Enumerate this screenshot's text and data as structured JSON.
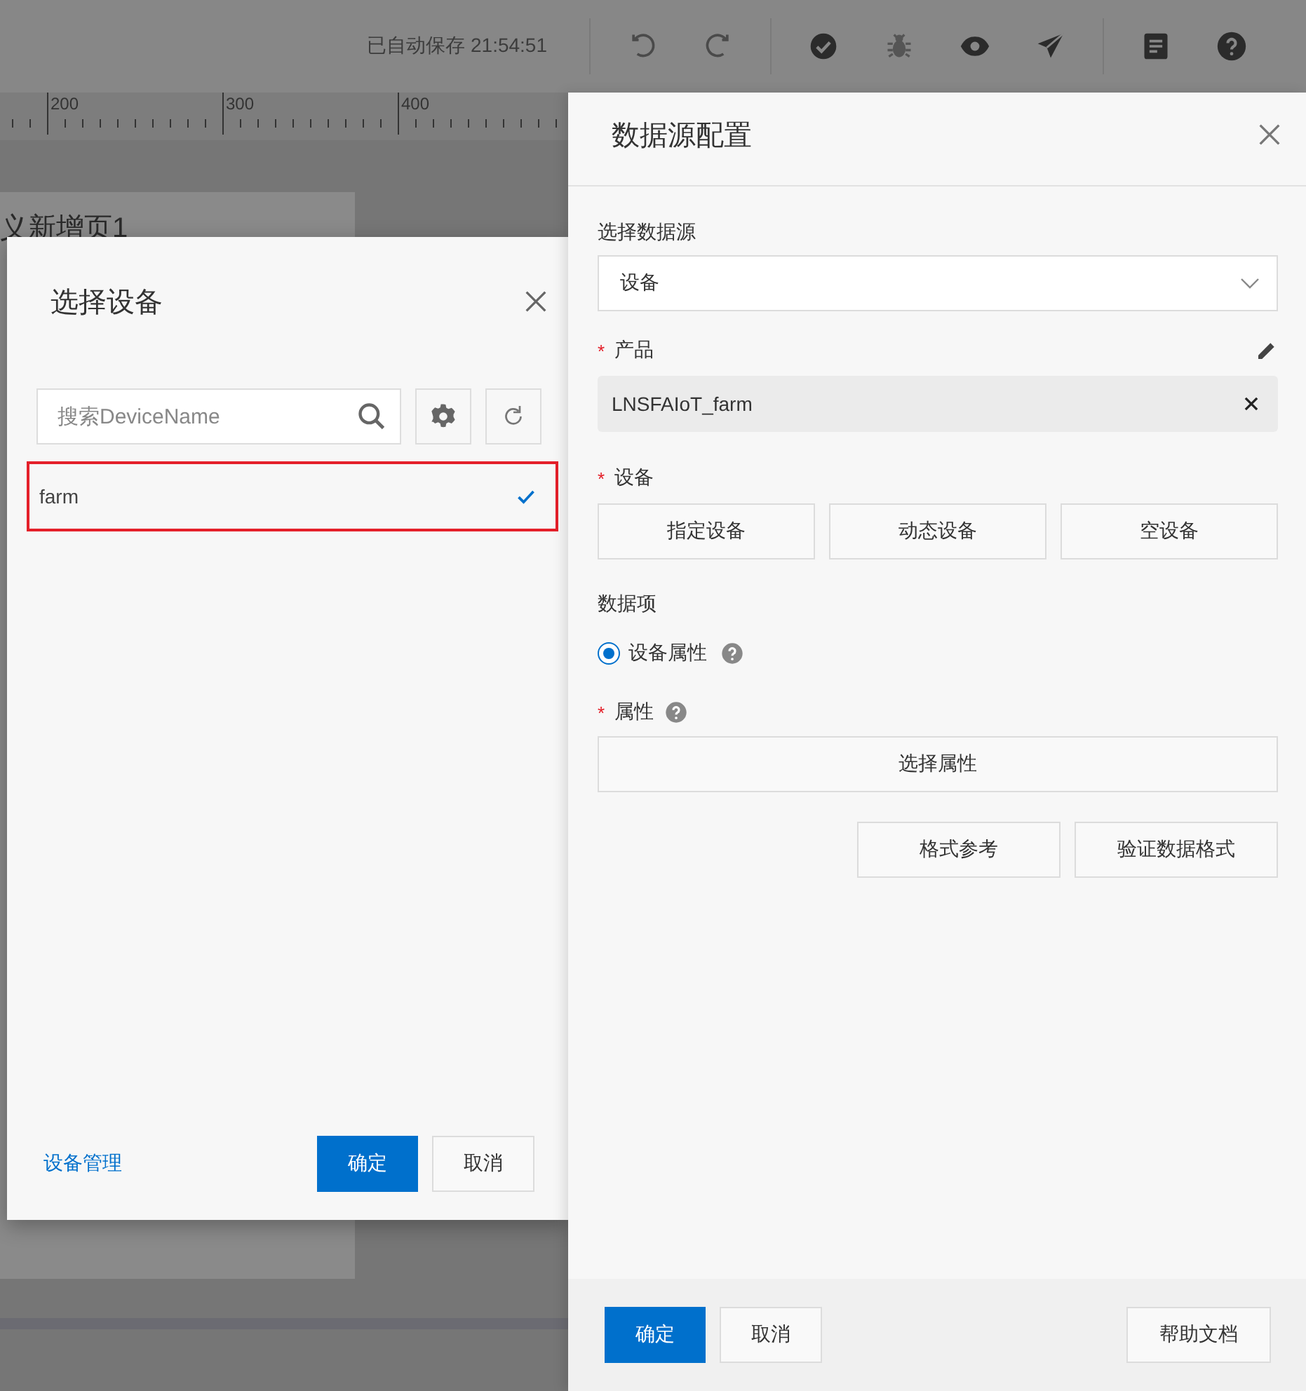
{
  "toolbar": {
    "autosave": "已自动保存 21:54:51"
  },
  "ruler": {
    "labels": [
      "200",
      "300",
      "400"
    ]
  },
  "canvas": {
    "page_title": "义新增页1"
  },
  "device_dialog": {
    "title": "选择设备",
    "search": {
      "placeholder": "搜索DeviceName"
    },
    "devices": [
      {
        "name": "farm",
        "selected": true,
        "highlighted": true
      }
    ],
    "link": "设备管理",
    "buttons": [
      {
        "label": "确定",
        "kind": "primary"
      },
      {
        "label": "取消",
        "kind": "default"
      }
    ]
  },
  "config_panel": {
    "title": "数据源配置",
    "source": {
      "label": "选择数据源",
      "value": "设备"
    },
    "product": {
      "required_mark": "*",
      "label": "产品",
      "value": "LNSFAIoT_farm"
    },
    "device": {
      "required_mark": "*",
      "label": "设备",
      "options": [
        "指定设备",
        "动态设备",
        "空设备"
      ]
    },
    "data_item": {
      "label": "数据项",
      "options": [
        {
          "label": "设备属性",
          "selected": true
        }
      ]
    },
    "property": {
      "required_mark": "*",
      "label": "属性",
      "button": "选择属性"
    },
    "format_buttons": [
      "格式参考",
      "验证数据格式"
    ],
    "footer": {
      "buttons": [
        {
          "label": "确定",
          "kind": "primary"
        },
        {
          "label": "取消",
          "kind": "default"
        }
      ],
      "help": "帮助文档"
    }
  }
}
